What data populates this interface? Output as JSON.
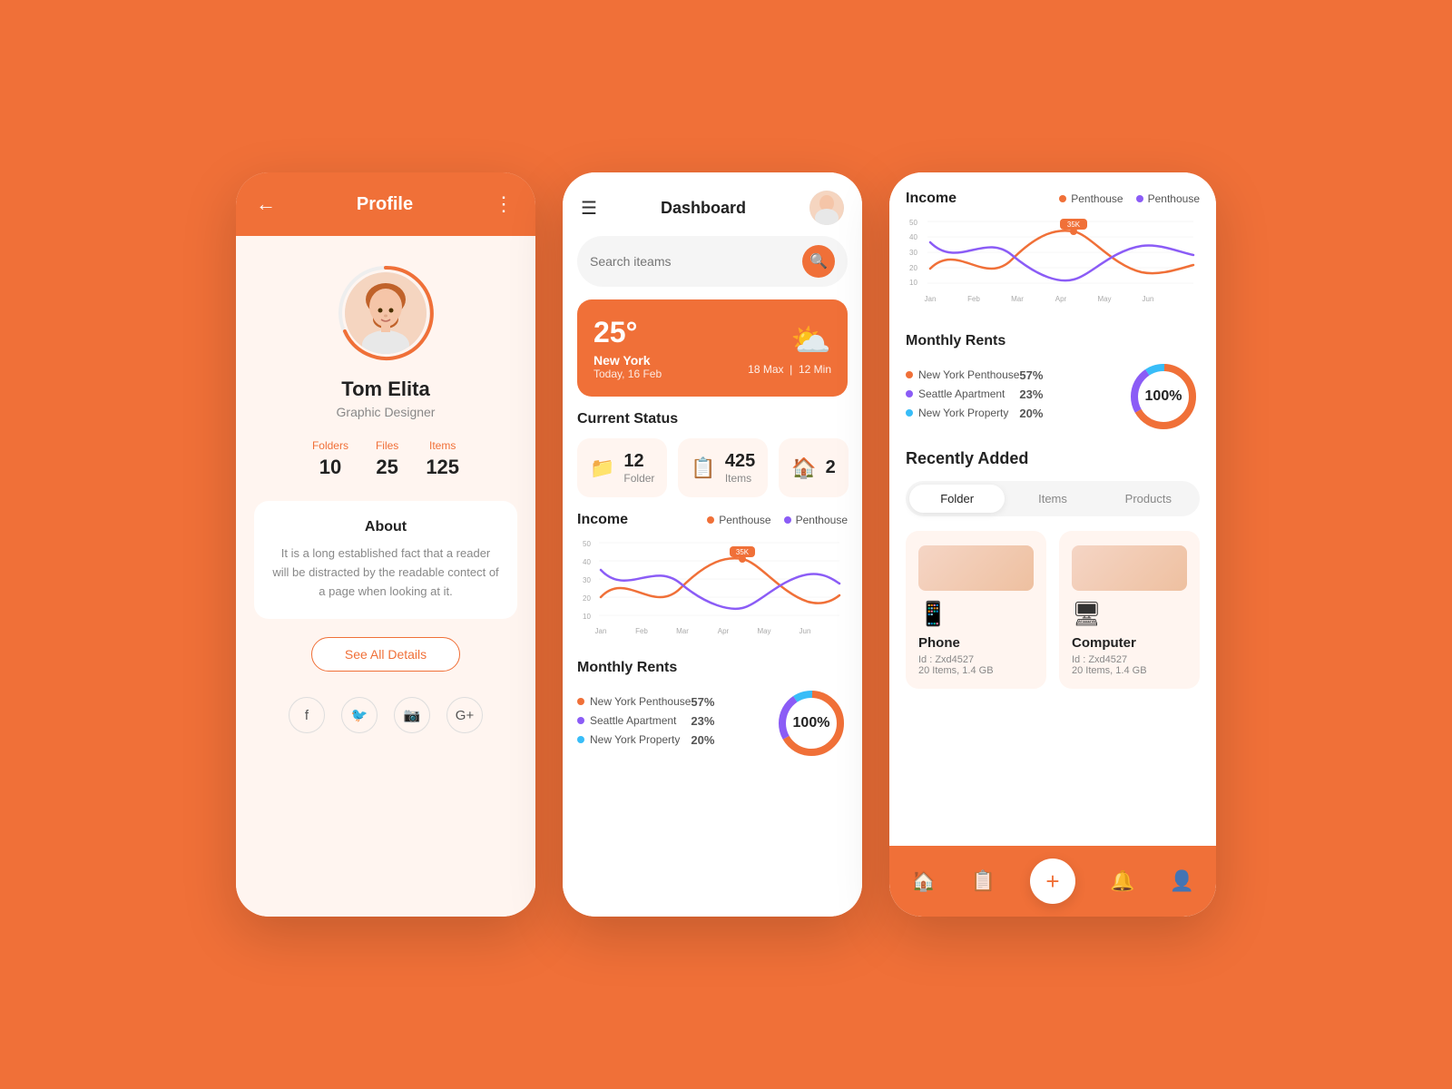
{
  "background": "#F07038",
  "phone1": {
    "header": {
      "back_label": "←",
      "title": "Profile",
      "dots_label": "⋮"
    },
    "profile": {
      "name": "Tom Elita",
      "role": "Graphic Designer",
      "stats": [
        {
          "label": "Folders",
          "value": "10"
        },
        {
          "label": "Files",
          "value": "25"
        },
        {
          "label": "Items",
          "value": "125"
        }
      ],
      "about_title": "About",
      "about_text": "It is a long established fact that a reader will be distracted by the readable contect of a page when looking at it.",
      "see_all_label": "See All Details"
    },
    "social": [
      "f",
      "🐦",
      "📷",
      "G+"
    ]
  },
  "phone2": {
    "header": {
      "menu_label": "☰",
      "title": "Dashboard"
    },
    "search": {
      "placeholder": "Search iteams"
    },
    "weather": {
      "temp": "25°",
      "city": "New York",
      "date": "Today, 16 Feb",
      "max": "18 Max",
      "min": "12 Min"
    },
    "current_status": {
      "title": "Current Status",
      "items": [
        {
          "icon": "📁",
          "value": "12",
          "label": "Folder"
        },
        {
          "icon": "📋",
          "value": "425",
          "label": "Items"
        },
        {
          "icon": "🏠",
          "value": "2",
          "label": ""
        }
      ]
    },
    "income": {
      "title": "Income",
      "legend": [
        {
          "label": "Penthouse",
          "color": "#F07038"
        },
        {
          "label": "Penthouse",
          "color": "#8B5CF6"
        }
      ],
      "months": [
        "Jan",
        "Feb",
        "Mar",
        "Apr",
        "May",
        "Jun"
      ],
      "peak_label": "35K"
    },
    "monthly_rents": {
      "title": "Monthly Rents",
      "items": [
        {
          "label": "New York Penthouse",
          "pct": "57%",
          "color": "#F07038"
        },
        {
          "label": "Seattle Apartment",
          "pct": "23%",
          "color": "#8B5CF6"
        },
        {
          "label": "New York Property",
          "pct": "20%",
          "color": "#38BDF8"
        }
      ],
      "donut_label": "100%"
    }
  },
  "phone3": {
    "income": {
      "title": "Income",
      "legend": [
        {
          "label": "Penthouse",
          "color": "#F07038"
        },
        {
          "label": "Penthouse",
          "color": "#8B5CF6"
        }
      ],
      "months": [
        "Jan",
        "Feb",
        "Mar",
        "Apr",
        "May",
        "Jun"
      ],
      "peak_label": "35K",
      "y_labels": [
        "50",
        "40",
        "30",
        "20",
        "10"
      ]
    },
    "monthly_rents": {
      "title": "Monthly Rents",
      "items": [
        {
          "label": "New York Penthouse",
          "pct": "57%",
          "color": "#F07038"
        },
        {
          "label": "Seattle Apartment",
          "pct": "23%",
          "color": "#8B5CF6"
        },
        {
          "label": "New York Property",
          "pct": "20%",
          "color": "#38BDF8"
        }
      ],
      "donut_label": "100%"
    },
    "recently_added": {
      "title": "Recently Added",
      "tabs": [
        "Folder",
        "Items",
        "Products"
      ],
      "active_tab": 0,
      "items": [
        {
          "icon": "📱",
          "name": "Phone",
          "id": "Id : Zxd4527",
          "meta": "20 Items, 1.4 GB"
        },
        {
          "icon": "🖥",
          "name": "Computer",
          "id": "Id : Zxd4527",
          "meta": "20 Items, 1.4 GB"
        }
      ]
    },
    "bottom_nav": {
      "items": [
        "🏠",
        "📋",
        "+",
        "🔔",
        "👤"
      ]
    }
  }
}
